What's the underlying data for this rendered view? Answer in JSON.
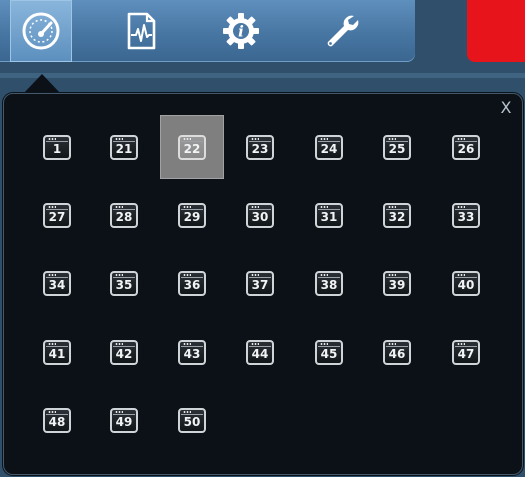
{
  "toolbar": {
    "buttons": [
      {
        "name": "dashboard",
        "icon": "speedometer-icon",
        "active": true
      },
      {
        "name": "report",
        "icon": "document-waveform-icon",
        "active": false
      },
      {
        "name": "info-settings",
        "icon": "gear-info-icon",
        "active": false
      },
      {
        "name": "tools",
        "icon": "wrench-icon",
        "active": false
      }
    ],
    "colors": {
      "bar": "#4876a3",
      "active": "#7aa8d2",
      "alert": "#e8141b"
    }
  },
  "panel": {
    "close_label": "X",
    "selected": "22",
    "items": [
      "1",
      "21",
      "22",
      "23",
      "24",
      "25",
      "26",
      "27",
      "28",
      "29",
      "30",
      "31",
      "32",
      "33",
      "34",
      "35",
      "36",
      "37",
      "38",
      "39",
      "40",
      "41",
      "42",
      "43",
      "44",
      "45",
      "46",
      "47",
      "48",
      "49",
      "50"
    ]
  }
}
